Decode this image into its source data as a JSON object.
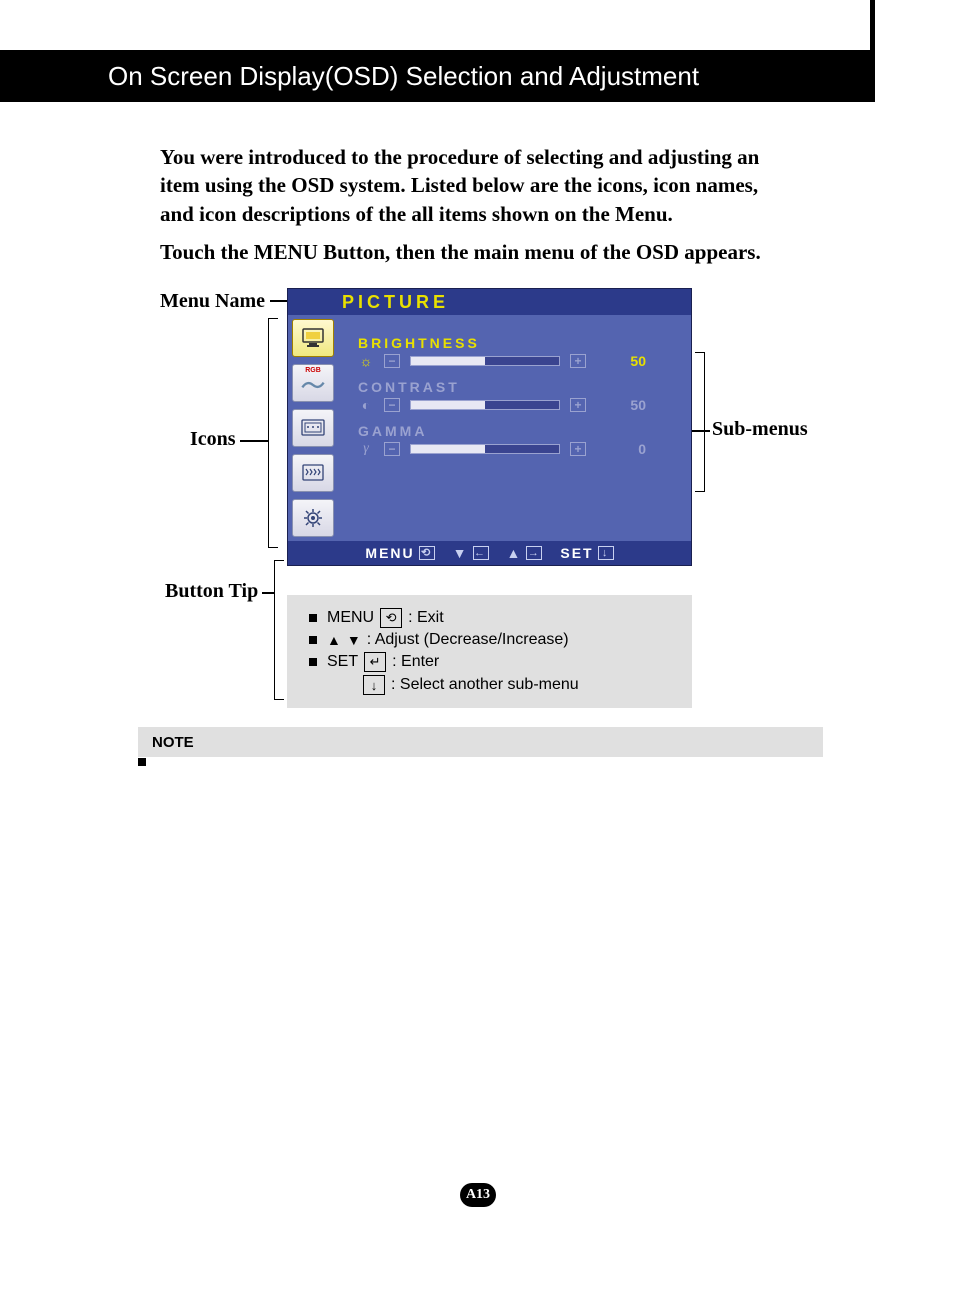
{
  "header_title": "On Screen Display(OSD) Selection and Adjustment",
  "intro_text": "You were introduced to the procedure of selecting and adjusting an item using the OSD system.  Listed below are the icons, icon names, and icon descriptions of the all items shown on the Menu.",
  "intro_text2": "Touch the MENU Button, then the main menu of the OSD appears.",
  "labels": {
    "menu_name": "Menu Name",
    "icons": "Icons",
    "button_tip": "Button Tip",
    "sub_menus": "Sub-menus"
  },
  "osd": {
    "title": "PICTURE",
    "submenus": [
      {
        "name": "BRIGHTNESS",
        "value": "50",
        "fill_pct": 50,
        "glyph": "sun",
        "active": true
      },
      {
        "name": "CONTRAST",
        "value": "50",
        "fill_pct": 50,
        "glyph": "circle",
        "active": false
      },
      {
        "name": "GAMMA",
        "value": "0",
        "fill_pct": 50,
        "glyph": "gamma",
        "active": false
      }
    ],
    "footer": {
      "menu": "MENU",
      "set": "SET"
    }
  },
  "tips": {
    "menu_label": "MENU",
    "menu_desc": ": Exit",
    "arrows_desc": ": Adjust (Decrease/Increase)",
    "set_label": "SET",
    "set_desc": ": Enter",
    "select_desc": ": Select another sub-menu"
  },
  "note_label": "NOTE",
  "page_number": "A13"
}
